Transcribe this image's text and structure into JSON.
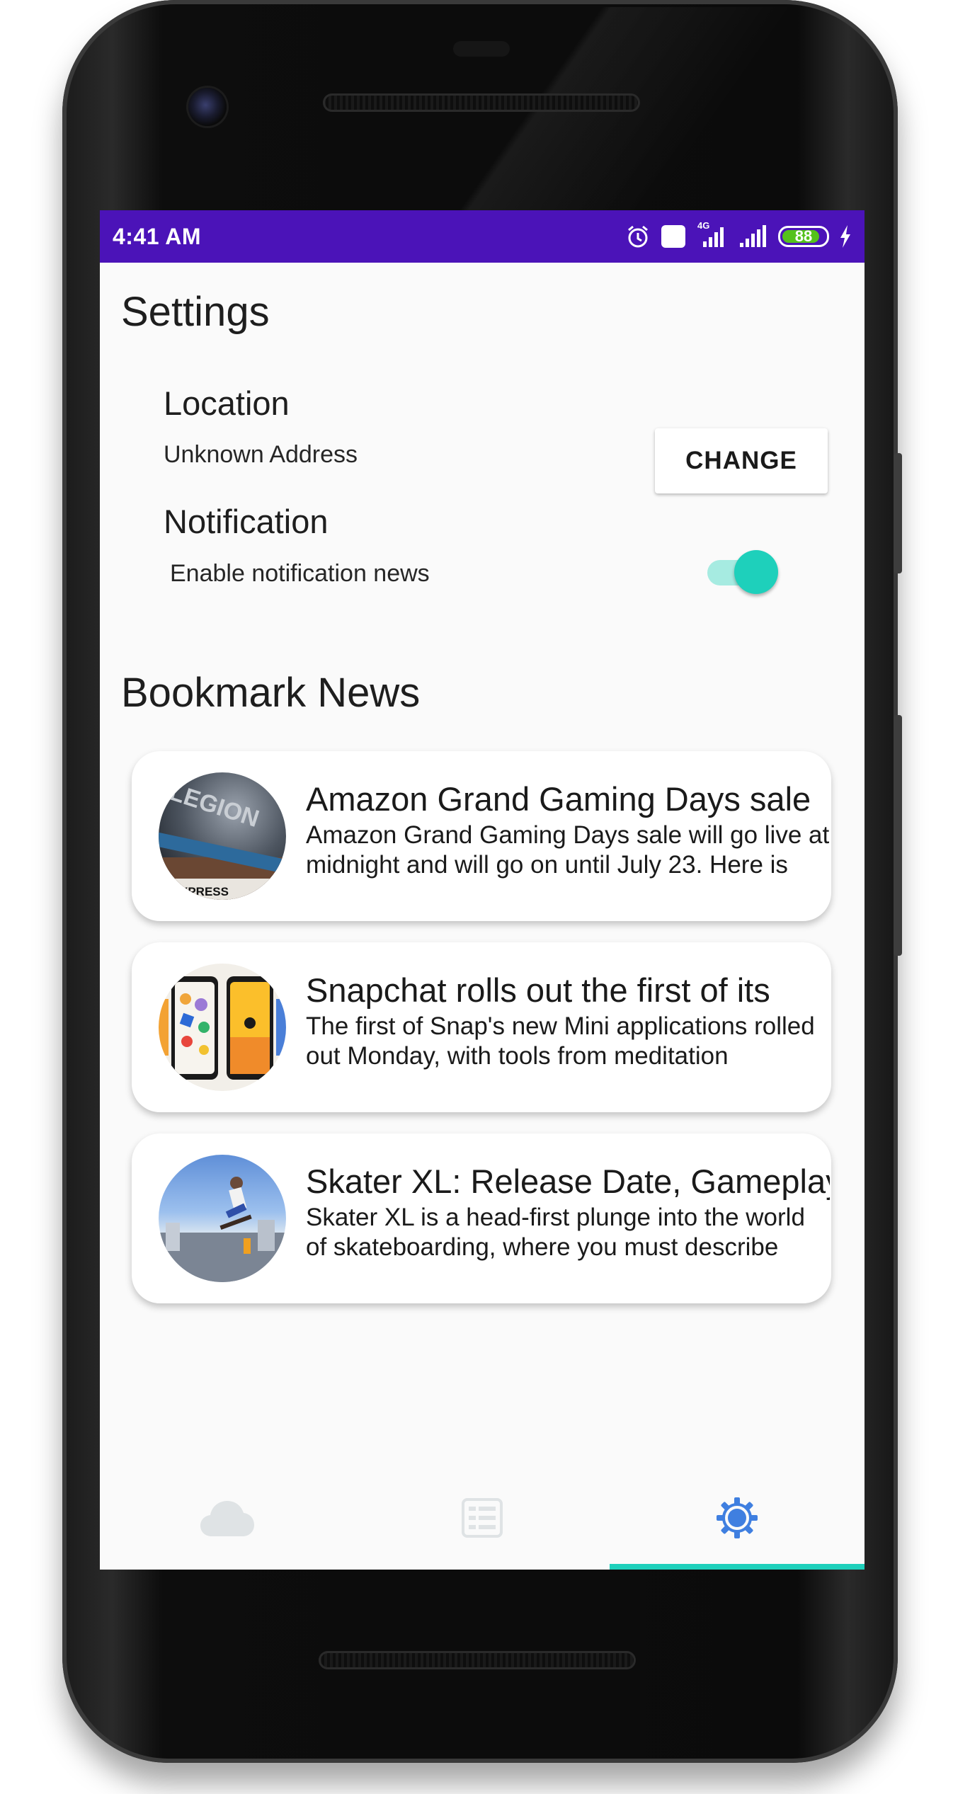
{
  "status_bar": {
    "time": "4:41 AM",
    "volte_label": "Vo LTE",
    "network_label": "4G",
    "battery_level": "88",
    "battery_fraction": 0.88,
    "colors": {
      "background": "#4b13b8",
      "battery_fill": "#55c21b"
    }
  },
  "settings": {
    "title": "Settings",
    "location": {
      "label": "Location",
      "value": "Unknown Address",
      "change_button": "CHANGE"
    },
    "notification": {
      "label": "Notification",
      "description": "Enable notification news",
      "enabled": true
    }
  },
  "bookmarks": {
    "title": "Bookmark News",
    "items": [
      {
        "title": "Amazon Grand Gaming Days sale",
        "description": "Amazon Grand Gaming Days sale will go live at midnight and will go on until July 23. Here is",
        "thumb_icon": "laptop-legion-thumbnail",
        "thumb_text": "LEGION",
        "thumb_caption": "XPRESS"
      },
      {
        "title": "Snapchat rolls out the first of its",
        "description": "The first of Snap's new Mini applications rolled out Monday, with tools from meditation",
        "thumb_icon": "phones-thumbnail"
      },
      {
        "title": "Skater XL: Release Date, Gameplay",
        "description": "Skater XL is a head-first plunge into the world of skateboarding, where you must describe",
        "thumb_icon": "skater-thumbnail"
      }
    ]
  },
  "bottom_nav": {
    "items": [
      {
        "icon": "cloud-icon",
        "active": false
      },
      {
        "icon": "news-list-icon",
        "active": false
      },
      {
        "icon": "settings-gear-icon",
        "active": true
      }
    ],
    "colors": {
      "active": "#3f7fe0",
      "inactive": "#dfe3e5",
      "indicator": "#1ed0bb"
    }
  },
  "colors": {
    "accent": "#1ed0bb",
    "switch_track": "#a6ebe1"
  }
}
